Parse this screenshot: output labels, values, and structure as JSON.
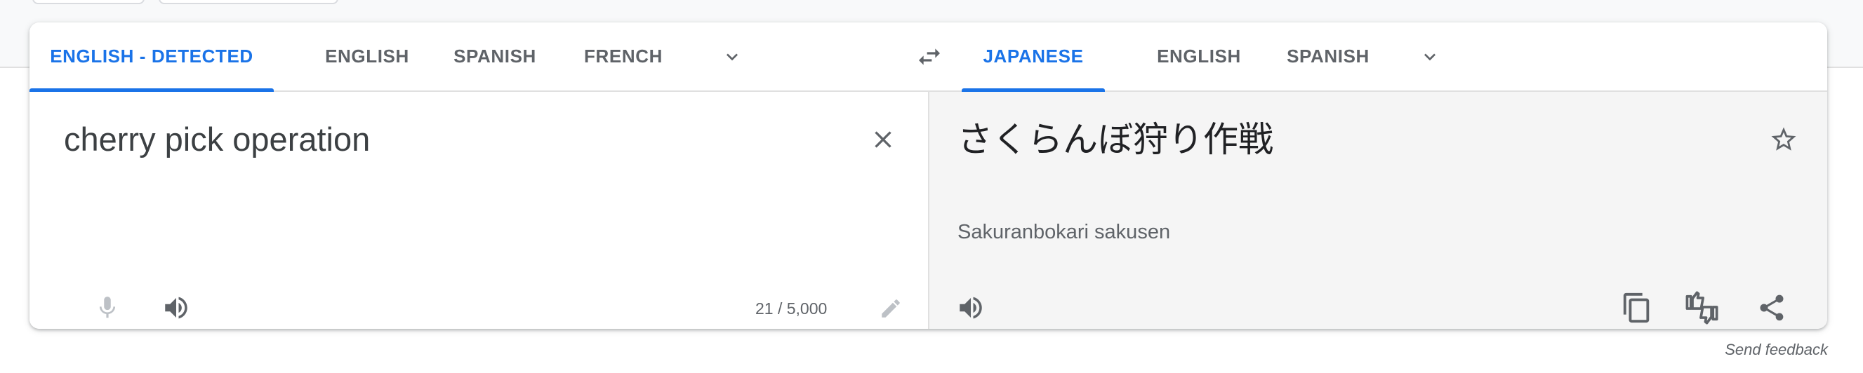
{
  "source_tabs": [
    {
      "label": "ENGLISH - DETECTED",
      "active": true
    },
    {
      "label": "ENGLISH",
      "active": false
    },
    {
      "label": "SPANISH",
      "active": false
    },
    {
      "label": "FRENCH",
      "active": false
    }
  ],
  "target_tabs": [
    {
      "label": "JAPANESE",
      "active": true
    },
    {
      "label": "ENGLISH",
      "active": false
    },
    {
      "label": "SPANISH",
      "active": false
    }
  ],
  "source": {
    "text": "cherry pick operation",
    "char_count": "21 / 5,000"
  },
  "target": {
    "text": "さくらんぼ狩り作戦",
    "romanization": "Sakuranbokari sakusen"
  },
  "footer": {
    "feedback_label": "Send feedback"
  },
  "icons": {
    "source_more": "chevron-down-icon",
    "swap": "swap-languages-icon",
    "target_more": "chevron-down-icon",
    "clear": "close-icon",
    "mic": "microphone-icon",
    "listen_source": "speaker-icon",
    "edit": "pencil-icon",
    "star": "star-icon",
    "listen_target": "speaker-icon",
    "copy": "copy-icon",
    "rate": "thumbs-rating-icon",
    "share": "share-icon"
  },
  "colors": {
    "accent": "#1a73e8",
    "tab_text": "#5f6368",
    "icon": "#5f6368",
    "disabled_icon": "#bdc1c6",
    "target_bg": "#f5f5f5"
  }
}
